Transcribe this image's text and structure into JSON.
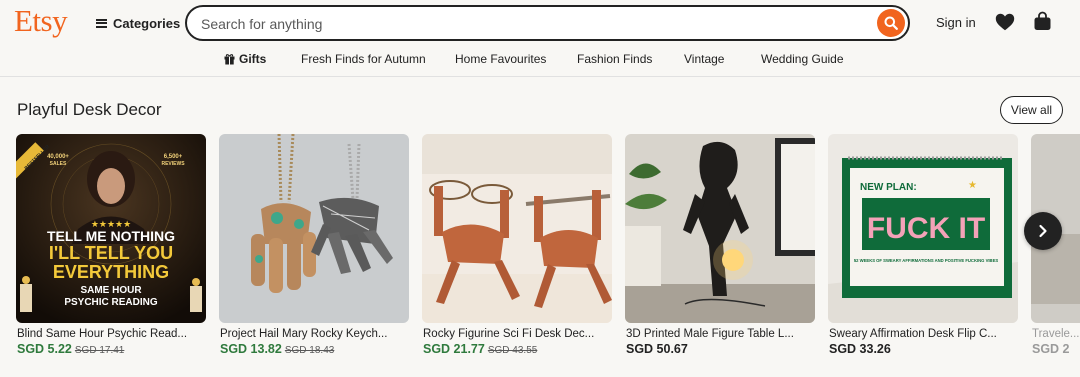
{
  "header": {
    "logo": "Etsy",
    "categories_label": "Categories",
    "search_placeholder": "Search for anything",
    "signin_label": "Sign in",
    "icons": {
      "search": "search-icon",
      "favorites": "heart-icon",
      "cart": "shopping-bag-icon",
      "menu": "hamburger-icon"
    },
    "accent_color": "#f1641e"
  },
  "nav": {
    "items": [
      {
        "label": "Gifts",
        "icon": "gift-icon"
      },
      {
        "label": "Fresh Finds for Autumn"
      },
      {
        "label": "Home Favourites"
      },
      {
        "label": "Fashion Finds"
      },
      {
        "label": "Vintage"
      },
      {
        "label": "Wedding Guide"
      }
    ]
  },
  "section": {
    "title": "Playful Desk Decor",
    "view_all_label": "View all"
  },
  "listings": [
    {
      "title": "Blind Same Hour Psychic Read...",
      "price": "SGD 5.22",
      "original_price": "SGD 17.41",
      "on_sale": true,
      "image_text": {
        "badge": "BESTSELLER",
        "sales": "40,000+\nSALES",
        "reviews": "6,500+\nREVIEWS",
        "stars": "★★★★★",
        "line1": "TELL ME NOTHING",
        "line2": "I'LL TELL YOU",
        "line3": "EVERYTHING",
        "line4": "SAME HOUR",
        "line5": "PSYCHIC READING"
      }
    },
    {
      "title": "Project Hail Mary Rocky Keych...",
      "price": "SGD 13.82",
      "original_price": "SGD 18.43",
      "on_sale": true
    },
    {
      "title": "Rocky Figurine Sci Fi Desk Dec...",
      "price": "SGD 21.77",
      "original_price": "SGD 43.55",
      "on_sale": true
    },
    {
      "title": "3D Printed Male Figure Table L...",
      "price": "SGD 50.67",
      "on_sale": false
    },
    {
      "title": "Sweary Affirmation Desk Flip C...",
      "price": "SGD 33.26",
      "on_sale": false,
      "image_text": {
        "heading": "NEW PLAN:",
        "big": "FUCK IT",
        "small": "52 WEEKS OF SWEARY AFFIRMATIONS AND POSITIVE FUCKING VIBES"
      }
    },
    {
      "title": "Travele...",
      "price": "SGD 2",
      "on_sale": false
    }
  ],
  "colors": {
    "sale_price": "#2f7a3d",
    "page_bg": "#f8f7f4"
  }
}
